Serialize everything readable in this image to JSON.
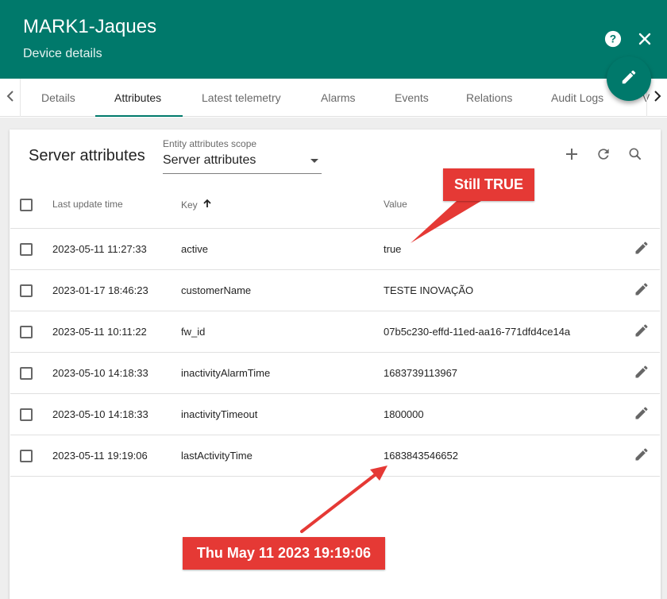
{
  "header": {
    "title": "MARK1-Jaques",
    "subtitle": "Device details",
    "color": "#00796b"
  },
  "icons": {
    "help": "help-circle-icon",
    "close": "close-icon",
    "edit": "pencil-icon",
    "add": "plus-icon",
    "refresh": "refresh-icon",
    "search": "search-icon",
    "sort": "arrow-up-icon"
  },
  "tabs": [
    {
      "label": "Details"
    },
    {
      "label": "Attributes"
    },
    {
      "label": "Latest telemetry"
    },
    {
      "label": "Alarms"
    },
    {
      "label": "Events"
    },
    {
      "label": "Relations"
    },
    {
      "label": "Audit Logs"
    },
    {
      "label": "V"
    }
  ],
  "active_tab": "Attributes",
  "panel": {
    "title": "Server attributes",
    "scope_label": "Entity attributes scope",
    "scope_value": "Server attributes"
  },
  "table": {
    "columns": [
      "Last update time",
      "Key",
      "Value"
    ],
    "sort_column": "Key",
    "rows": [
      {
        "time": "2023-05-11 11:27:33",
        "key": "active",
        "value": "true"
      },
      {
        "time": "2023-01-17 18:46:23",
        "key": "customerName",
        "value": "TESTE INOVAÇÃO"
      },
      {
        "time": "2023-05-11 10:11:22",
        "key": "fw_id",
        "value": "07b5c230-effd-11ed-aa16-771dfd4ce14a"
      },
      {
        "time": "2023-05-10 14:18:33",
        "key": "inactivityAlarmTime",
        "value": "1683739113967"
      },
      {
        "time": "2023-05-10 14:18:33",
        "key": "inactivityTimeout",
        "value": "1800000"
      },
      {
        "time": "2023-05-11 19:19:06",
        "key": "lastActivityTime",
        "value": "1683843546652"
      }
    ]
  },
  "annotations": [
    {
      "text": "Still TRUE"
    },
    {
      "text": "Thu May 11 2023 19:19:06"
    }
  ],
  "annotation_color": "#e53935"
}
